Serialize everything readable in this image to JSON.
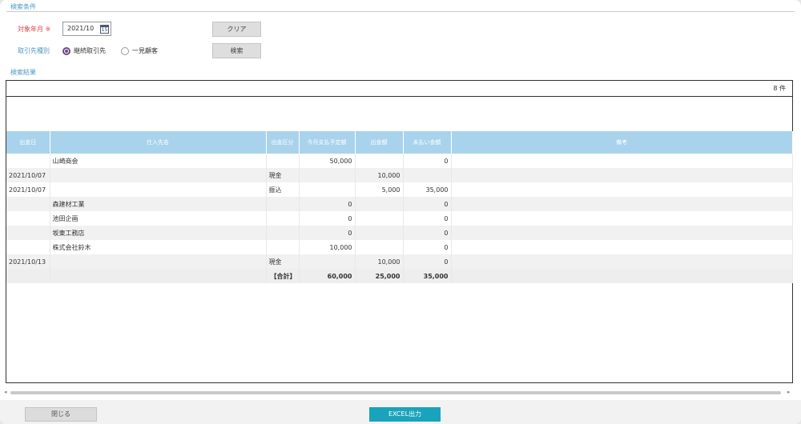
{
  "search": {
    "section_title": "検索条件",
    "target_month_label": "対象年月",
    "required_mark": "※",
    "target_month_value": "2021/10",
    "calendar_day": "15",
    "partner_type_label": "取引先種別",
    "radio_continuous": "継続取引先",
    "radio_onetime": "一見顧客",
    "clear_label": "クリア",
    "search_label": "検索"
  },
  "results": {
    "section_title": "検索結果",
    "count_text": "8 件",
    "columns": [
      "出金日",
      "仕入先名",
      "出金区分",
      "今月支払予定額",
      "出金額",
      "未払い金額",
      "備考"
    ],
    "rows": [
      [
        "",
        "山崎商会",
        "",
        "50,000",
        "",
        "0",
        ""
      ],
      [
        "2021/10/07",
        "",
        "現金",
        "",
        "10,000",
        "",
        ""
      ],
      [
        "2021/10/07",
        "",
        "振込",
        "",
        "5,000",
        "35,000",
        ""
      ],
      [
        "",
        "森建材工業",
        "",
        "0",
        "",
        "0",
        ""
      ],
      [
        "",
        "池田企画",
        "",
        "0",
        "",
        "0",
        ""
      ],
      [
        "",
        "坂東工務店",
        "",
        "0",
        "",
        "0",
        ""
      ],
      [
        "",
        "株式会社鈴木",
        "",
        "10,000",
        "",
        "0",
        ""
      ],
      [
        "2021/10/13",
        "",
        "現金",
        "",
        "10,000",
        "0",
        ""
      ]
    ],
    "total": [
      "",
      "",
      "【合計】",
      "60,000",
      "25,000",
      "35,000",
      ""
    ]
  },
  "footer": {
    "close_label": "閉じる",
    "excel_label": "EXCEL出力"
  },
  "colors": {
    "header_bg": "#a9d3ec",
    "label_blue": "#4d98c6",
    "required_red": "#e04848",
    "excel_button": "#1aa3bc"
  }
}
